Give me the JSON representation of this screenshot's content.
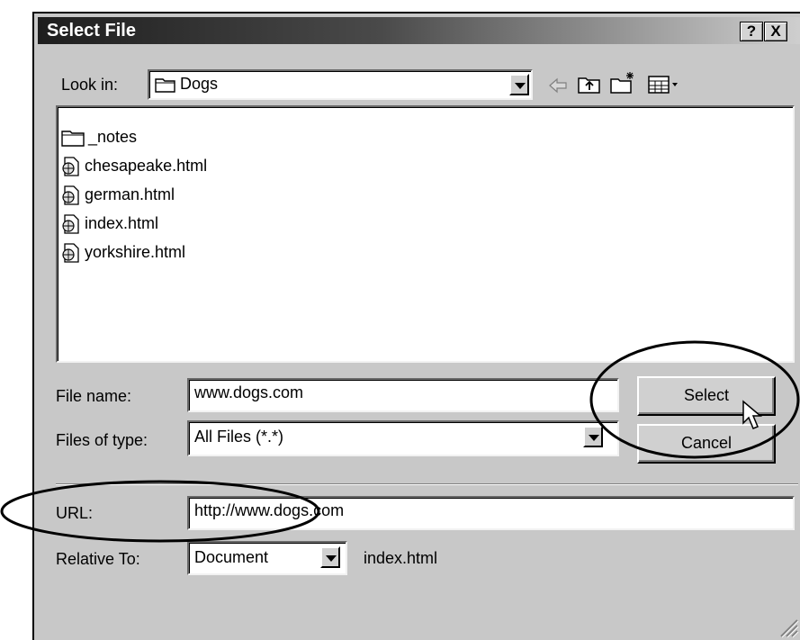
{
  "dialog": {
    "title": "Select File",
    "help_button": "?",
    "close_button": "X"
  },
  "look_in": {
    "label": "Look in:",
    "value": "Dogs"
  },
  "toolbar": {
    "icons": [
      "back-arrow-icon",
      "up-folder-icon",
      "new-folder-icon",
      "view-menu-icon"
    ]
  },
  "files": [
    {
      "name": "_notes",
      "icon": "folder-icon"
    },
    {
      "name": "chesapeake.html",
      "icon": "html-file-icon"
    },
    {
      "name": "german.html",
      "icon": "html-file-icon"
    },
    {
      "name": "index.html",
      "icon": "html-file-icon"
    },
    {
      "name": "yorkshire.html",
      "icon": "html-file-icon"
    }
  ],
  "file_name": {
    "label": "File name:",
    "value": "www.dogs.com"
  },
  "file_type": {
    "label": "Files of type:",
    "value": "All Files (*.*)"
  },
  "buttons": {
    "select": "Select",
    "cancel": "Cancel"
  },
  "url": {
    "label": "URL:",
    "value": "http://www.dogs.com"
  },
  "relative_to": {
    "label": "Relative To:",
    "value": "Document",
    "file": "index.html"
  }
}
